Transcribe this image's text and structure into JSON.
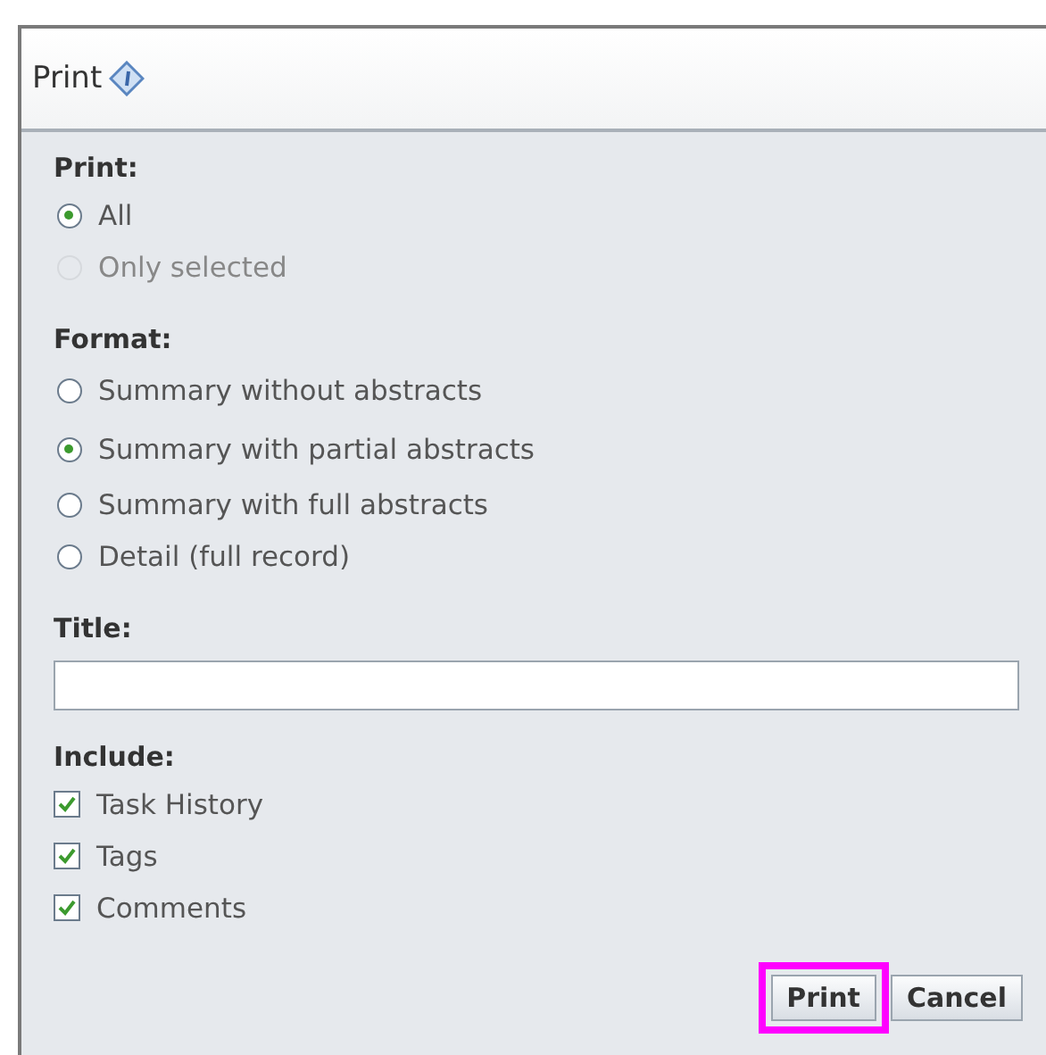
{
  "window": {
    "title": "Print"
  },
  "print_section": {
    "label": "Print:",
    "options": [
      {
        "label": "All",
        "selected": true,
        "disabled": false
      },
      {
        "label": "Only selected",
        "selected": false,
        "disabled": true
      }
    ]
  },
  "format_section": {
    "label": "Format:",
    "options": [
      {
        "label": "Summary without abstracts",
        "selected": false,
        "disabled": false
      },
      {
        "label": "Summary with partial abstracts",
        "selected": true,
        "disabled": false
      },
      {
        "label": "Summary with full abstracts",
        "selected": false,
        "disabled": false
      },
      {
        "label": "Detail (full record)",
        "selected": false,
        "disabled": false
      }
    ]
  },
  "title_field": {
    "label": "Title:"
  },
  "include_section": {
    "label": "Include:",
    "options": [
      {
        "label": "Task History",
        "checked": true
      },
      {
        "label": "Tags",
        "checked": true
      },
      {
        "label": "Comments",
        "checked": true
      }
    ]
  },
  "buttons": [
    {
      "label": "Print",
      "highlighted": true
    },
    {
      "label": "Cancel",
      "highlighted": false
    }
  ]
}
